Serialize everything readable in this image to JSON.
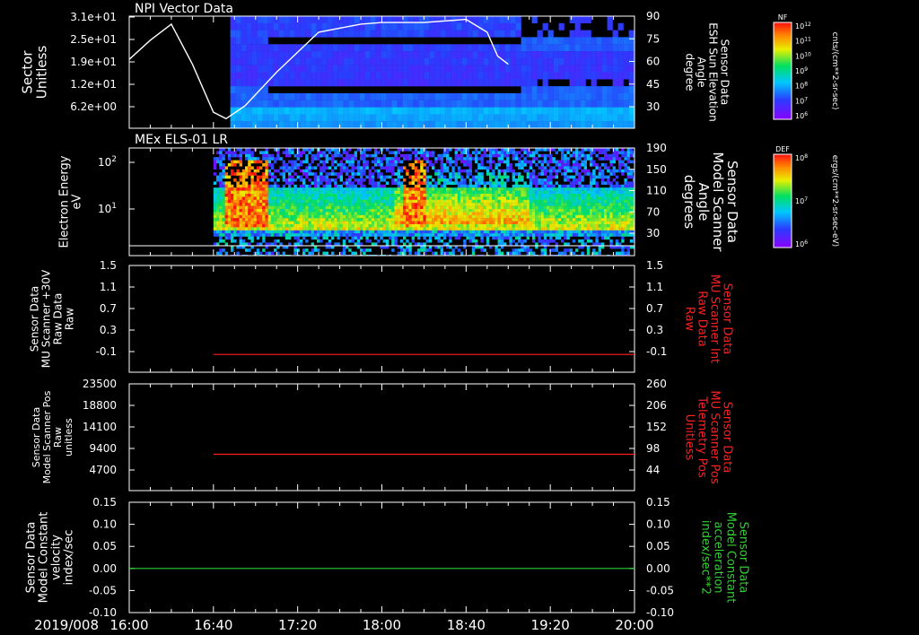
{
  "date_label": "2019/008",
  "time_ticks": [
    "16:00",
    "16:40",
    "17:20",
    "18:00",
    "18:40",
    "19:20",
    "20:00"
  ],
  "colors": {
    "red": "#ff2020",
    "green": "#30d030",
    "frame": "#ffffff"
  },
  "chart_data": [
    {
      "type": "heatmap",
      "title": "NPI Vector Data",
      "ylabel_left": [
        "Sector",
        "Unitless"
      ],
      "yticks_left": [
        "3.1e+01",
        "2.5e+01",
        "1.9e+01",
        "1.2e+01",
        "6.2e+00"
      ],
      "ylabel_right": [
        "Sensor Data",
        "ESH Sun Elevation",
        "Angle",
        "degree"
      ],
      "yticks_right": [
        "90",
        "75",
        "60",
        "45",
        "30"
      ],
      "colorbar": {
        "label": "NF",
        "units": "cnts/(cm**2-sr-sec)",
        "ticks": [
          "10^12",
          "10^11",
          "10^10",
          "10^9",
          "10^8",
          "10^7",
          "10^6"
        ]
      },
      "data_start": "16:48",
      "overlay_line": {
        "name": "ESH Sun Elevation Angle",
        "x": [
          "16:00",
          "16:10",
          "16:20",
          "16:30",
          "16:40",
          "16:46",
          "16:55",
          "17:10",
          "17:30",
          "17:50",
          "18:00",
          "18:20",
          "18:40",
          "18:50",
          "18:55",
          "19:00"
        ],
        "y": [
          63,
          75,
          85,
          60,
          30,
          26,
          34,
          55,
          80,
          85,
          86,
          86,
          88,
          80,
          65,
          60
        ]
      }
    },
    {
      "type": "heatmap",
      "title": "MEx ELS-01 LR",
      "ylabel_left": [
        "Electron Energy",
        "eV"
      ],
      "yticks_left": [
        "10^2",
        "10^1"
      ],
      "ylabel_right": [
        "Sensor Data",
        "Model Scanner",
        "Angle",
        "degrees"
      ],
      "yticks_right": [
        "190",
        "150",
        "110",
        "70",
        "30"
      ],
      "colorbar": {
        "label": "DEF",
        "units": "ergs/(cm**2-sr-sec-eV)",
        "ticks": [
          "10^8",
          "10^7",
          "10^6"
        ]
      },
      "data_start": "16:40",
      "intense_intervals": [
        [
          "16:45",
          "17:05"
        ],
        [
          "18:10",
          "18:20"
        ]
      ]
    },
    {
      "type": "line",
      "ylabel_left": [
        "Sensor Data",
        "MU Scanner +30V",
        "Raw Data",
        "Raw"
      ],
      "yticks_left": [
        "1.5",
        "1.1",
        "0.7",
        "0.3",
        "-0.1"
      ],
      "ylabel_right": [
        "Sensor Data",
        "MU Scanner Int",
        "Raw Data",
        "Raw"
      ],
      "yticks_right": [
        "1.5",
        "1.1",
        "0.7",
        "0.3",
        "-0.1"
      ],
      "ylim": [
        -0.3,
        1.5
      ],
      "series": [
        {
          "x": [
            "16:40",
            "20:00"
          ],
          "y": [
            0.0,
            0.0
          ],
          "color": "red"
        }
      ]
    },
    {
      "type": "line",
      "ylabel_left": [
        "Sensor Data",
        "Model Scanner Pos",
        "Raw",
        "unitless"
      ],
      "yticks_left": [
        "23500",
        "18800",
        "14100",
        "9400",
        "4700"
      ],
      "ylabel_right": [
        "Sensor Data",
        "MU Scanner Pos",
        "Telemetry Pos",
        "Unitless"
      ],
      "yticks_right": [
        "260",
        "206",
        "152",
        "98",
        "44"
      ],
      "ylim": [
        0,
        23500
      ],
      "series": [
        {
          "x": [
            "16:40",
            "20:00"
          ],
          "y": [
            8000,
            8000
          ],
          "color": "red"
        }
      ]
    },
    {
      "type": "line",
      "ylabel_left": [
        "Sensor Data",
        "Model Constant",
        "velocity",
        "index/sec"
      ],
      "yticks_left": [
        "0.15",
        "0.10",
        "0.05",
        "0.00",
        "-0.05",
        "-0.10"
      ],
      "ylabel_right": [
        "Sensor Data",
        "Model Constant",
        "acceleration",
        "index/sec**2"
      ],
      "yticks_right": [
        "0.15",
        "0.10",
        "0.05",
        "0.00",
        "-0.05",
        "-0.10"
      ],
      "ylim": [
        -0.1,
        0.15
      ],
      "series": [
        {
          "x": [
            "16:00",
            "20:00"
          ],
          "y": [
            0.0,
            0.0
          ],
          "color": "green"
        }
      ]
    }
  ]
}
